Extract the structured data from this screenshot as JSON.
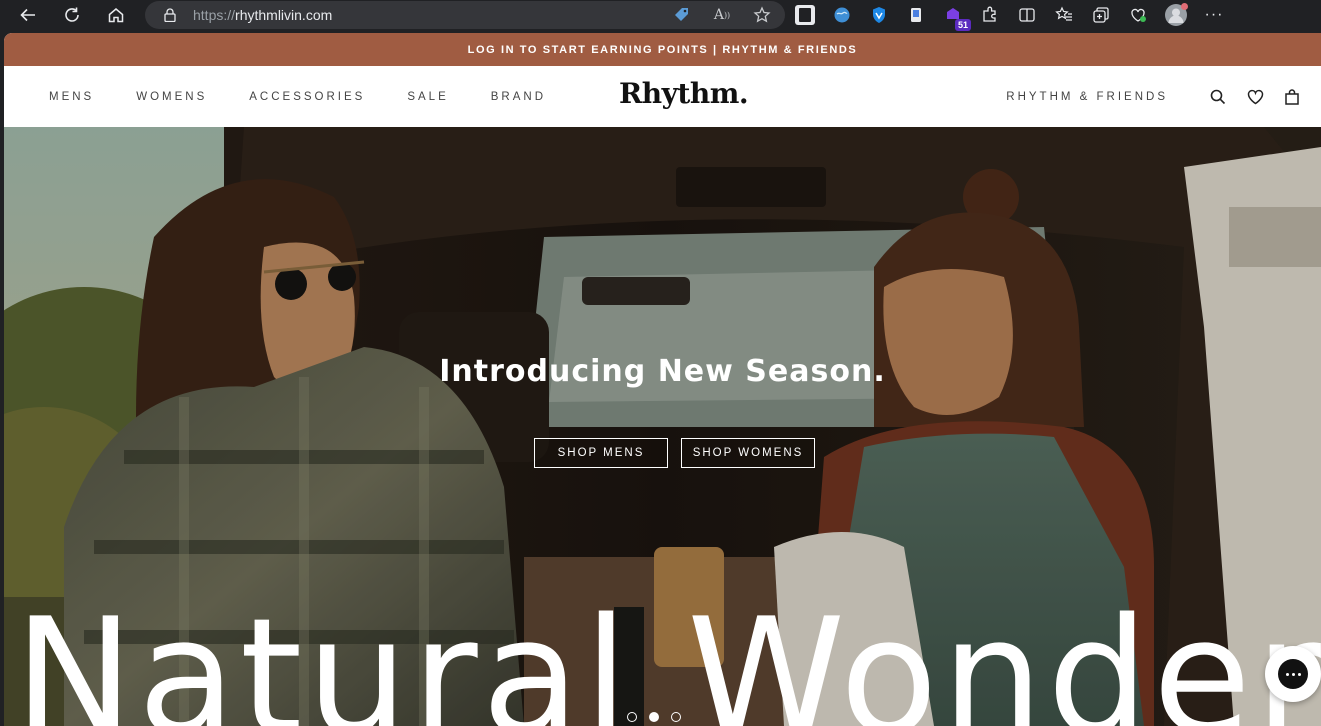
{
  "browser": {
    "url_protocol": "https://",
    "url_host": "rhythmlivin.com",
    "extension_badge": "51"
  },
  "promo": {
    "text": "LOG IN TO START EARNING POINTS | RHYTHM & FRIENDS"
  },
  "header": {
    "logo": "Rhythm.",
    "nav": [
      "MENS",
      "WOMENS",
      "ACCESSORIES",
      "SALE",
      "BRAND"
    ],
    "friends_link": "RHYTHM & FRIENDS"
  },
  "hero": {
    "title": "Introducing New Season.",
    "shop_mens": "SHOP MENS",
    "shop_womens": "SHOP WOMENS",
    "big_text": "Natural Wonder",
    "slides": 3,
    "active_slide": 2
  },
  "colors": {
    "promo_bg": "#a05c42",
    "browser_bg": "#202124"
  }
}
